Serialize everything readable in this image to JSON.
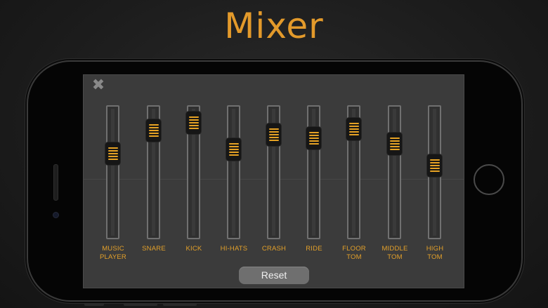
{
  "app": {
    "title": "Mixer"
  },
  "mixer": {
    "close_symbol": "✖",
    "reset_label": "Reset",
    "accent_color": "#e39a2b",
    "channels": [
      {
        "label": "MUSIC\nPLAYER",
        "level": 0.67
      },
      {
        "label": "SNARE",
        "level": 0.88
      },
      {
        "label": "KICK",
        "level": 0.95
      },
      {
        "label": "HI-HATS",
        "level": 0.71
      },
      {
        "label": "CRASH",
        "level": 0.84
      },
      {
        "label": "RIDE",
        "level": 0.81
      },
      {
        "label": "FLOOR\nTOM",
        "level": 0.89
      },
      {
        "label": "MIDDLE\nTOM",
        "level": 0.76
      },
      {
        "label": "HIGH\nTOM",
        "level": 0.56
      }
    ]
  }
}
